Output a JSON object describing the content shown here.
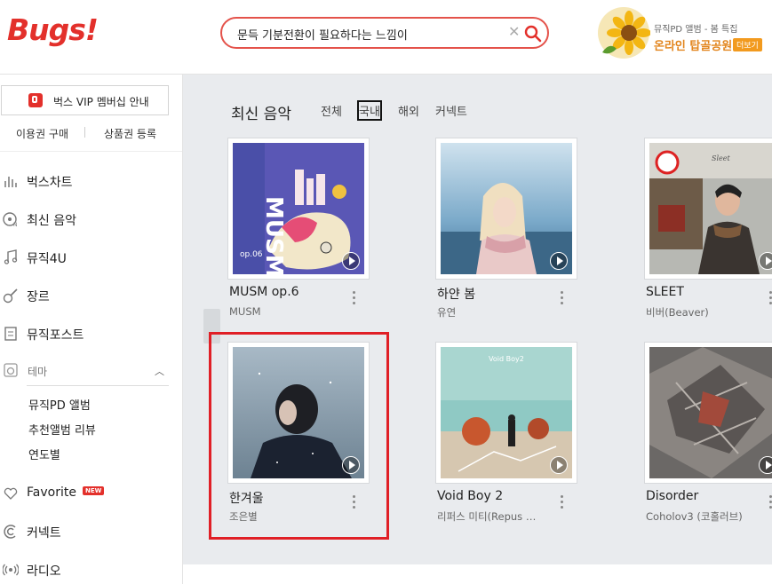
{
  "header": {
    "logo": "Bugs!",
    "search_query": "문득 기분전환이 필요하다는 느낌이",
    "promo": {
      "subtitle": "뮤직PD 앨범 - 봄 특집",
      "title": "온라인 탑골공원",
      "more_label": "더보기"
    }
  },
  "sidebar": {
    "vip_label": "벅스 VIP 멤버십 안내",
    "buy_label": "이용권 구매",
    "register_label": "상품권 등록",
    "nav": [
      {
        "label": "벅스차트",
        "icon": "chart-icon"
      },
      {
        "label": "최신 음악",
        "icon": "new-music-icon"
      },
      {
        "label": "뮤직4U",
        "icon": "music-note-icon"
      },
      {
        "label": "장르",
        "icon": "guitar-icon"
      },
      {
        "label": "뮤직포스트",
        "icon": "post-icon"
      }
    ],
    "theme_label": "테마",
    "theme_items": [
      "뮤직PD 앨범",
      "추천앨범 리뷰",
      "연도별"
    ],
    "favorite_label": "Favorite",
    "new_badge": "NEW",
    "connect_label": "커넥트",
    "radio_label": "라디오"
  },
  "main": {
    "section_title": "최신 음악",
    "filters": [
      "전체",
      "국내",
      "해외",
      "커넥트"
    ],
    "active_filter": "국내",
    "albums": [
      {
        "title": "MUSM op.6",
        "artist": "MUSM"
      },
      {
        "title": "하얀 봄",
        "artist": "유연"
      },
      {
        "title": "SLEET",
        "artist": "비버(Beaver)"
      },
      {
        "title": "한겨울",
        "artist": "조은별"
      },
      {
        "title": "Void Boy 2",
        "artist": "리퍼스 미티(Repus …"
      },
      {
        "title": "Disorder",
        "artist": "Coholov3 (코홀러브)"
      }
    ],
    "cover_texts": {
      "musm_big": "MUSM",
      "musm_op": "op.06",
      "voidboy": "Void Boy2",
      "sleet": "Sleet"
    }
  },
  "colors": {
    "brand": "#e3302b",
    "highlight": "#e01f26",
    "main_bg": "#e9ebee"
  }
}
